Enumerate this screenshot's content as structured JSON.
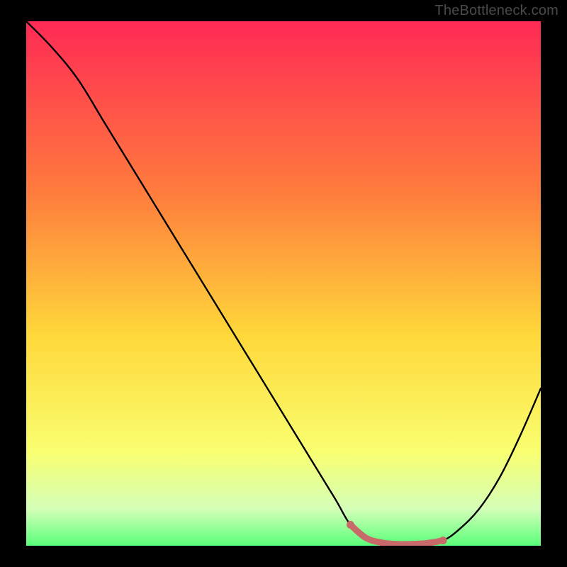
{
  "watermark": "TheBottleneck.com",
  "colors": {
    "grad_top": "#ff2a55",
    "grad_mid1": "#ff7a3d",
    "grad_mid2": "#ffd83a",
    "grad_mid3": "#f9ff70",
    "grad_bot1": "#d4ffb8",
    "grad_bot2": "#5aff7a",
    "curve": "#000000",
    "highlight": "#c96a6a",
    "frame": "#000000"
  },
  "chart_data": {
    "type": "line",
    "title": "",
    "xlabel": "",
    "ylabel": "",
    "xlim": [
      0,
      100
    ],
    "ylim": [
      0,
      100
    ],
    "grid": false,
    "legend": false,
    "series": [
      {
        "name": "curve",
        "x": [
          0,
          5,
          10,
          15,
          20,
          25,
          30,
          35,
          40,
          45,
          50,
          55,
          60,
          63,
          66,
          69,
          72,
          75,
          78,
          81,
          84,
          88,
          92,
          96,
          100
        ],
        "y": [
          100,
          95,
          89,
          81,
          73,
          65,
          57,
          49,
          41,
          33,
          25,
          17,
          9,
          4,
          1.5,
          0.6,
          0.3,
          0.3,
          0.5,
          1.0,
          3,
          7,
          13,
          21,
          30
        ]
      },
      {
        "name": "highlight",
        "x": [
          63,
          66,
          69,
          72,
          75,
          78,
          81
        ],
        "y": [
          4,
          1.5,
          0.6,
          0.3,
          0.3,
          0.5,
          1.0
        ]
      }
    ]
  }
}
